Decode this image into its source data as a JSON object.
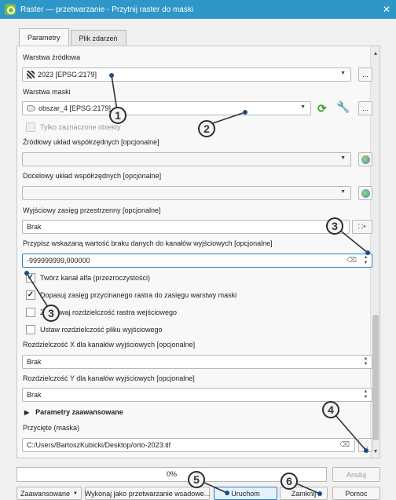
{
  "window": {
    "title": "Raster — przetwarzanie - Przytnij raster do maski",
    "close": "✕"
  },
  "tabs": [
    {
      "label": "Parametry"
    },
    {
      "label": "Plik zdarzeń"
    }
  ],
  "form": {
    "source_layer_label": "Warstwa źródłowa",
    "source_layer_value": "2023 [EPSG:2179]",
    "mask_layer_label": "Warstwa maski",
    "mask_layer_value": "obszar_4 [EPSG:2179]",
    "selected_only_label": "Tylko zaznaczone obiekty",
    "source_crs_label": "Źródłowy układ współrzędnych [opcjonalne]",
    "target_crs_label": "Docelowy układ współrzędnych [opcjonalne]",
    "extent_label": "Wyjściowy zasięg przestrzenny [opcjonalne]",
    "extent_value": "Brak",
    "nodata_label": "Przypisz wskazaną wartość braku danych do kanałów wyjściowych [opcjonalne]",
    "nodata_value": "-999999999,000000",
    "alpha_label": "Twórz kanał alfa (przezroczystości)",
    "alpha_checked": true,
    "fit_extent_label": "Dopasuj zasięg przycinanego rastra do zasięgu warstwy maski",
    "fit_extent_checked": true,
    "keep_res_label": "Zachowaj rozdzielczość rastra wejściowego",
    "keep_res_checked": false,
    "set_res_label": "Ustaw rozdzielczość pliku wyjściowego",
    "set_res_checked": false,
    "xres_label": "Rozdzielczość X dla kanałów wyjściowych [opcjonalne]",
    "xres_value": "Brak",
    "yres_label": "Rozdzielczość Y dla kanałów wyjściowych [opcjonalne]",
    "yres_value": "Brak",
    "advanced_label": "Parametry zaawansowane",
    "clipped_label": "Przycięte (maska)",
    "clipped_value": "C:/Users/BartoszKubicki/Desktop/orto-2023.tif",
    "ellipsis": "..."
  },
  "bottom": {
    "progress_percent": 0,
    "progress_text": "0%",
    "cancel_label": "Anuluj",
    "advanced_label": "Zaawansowane",
    "batch_label": "Wykonaj jako przetwarzanie wsadowe...",
    "run_label": "Uruchom",
    "close_label": "Zamknij",
    "help_label": "Pomoc"
  },
  "callouts": [
    "1",
    "2",
    "3",
    "3",
    "4",
    "5",
    "6"
  ],
  "colors": {
    "titlebar": "#2e97c7",
    "accent": "#1d4d80"
  }
}
